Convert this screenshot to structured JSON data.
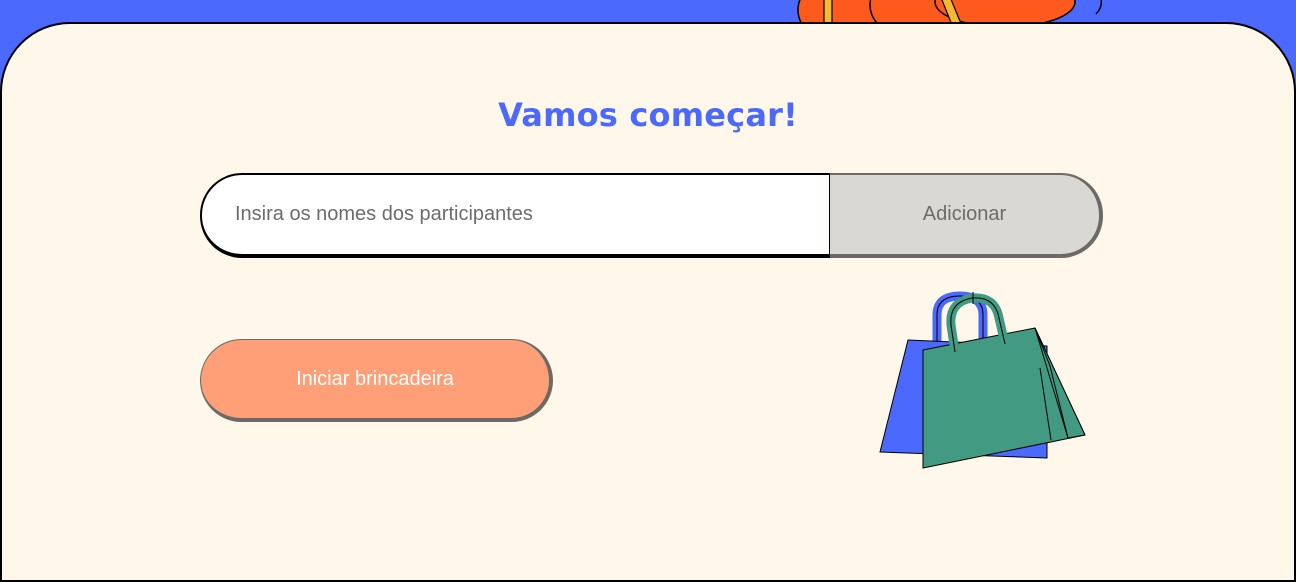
{
  "page": {
    "title": "Vamos começar!"
  },
  "form": {
    "name_placeholder": "Insira os nomes dos participantes",
    "name_value": "",
    "add_label": "Adicionar"
  },
  "actions": {
    "start_label": "Iniciar brincadeira"
  },
  "colors": {
    "header_bg": "#4b69fd",
    "card_bg": "#fff8ea",
    "title": "#4b69fd",
    "add_button": "#d9d8d2",
    "start_button": "#fe9f77",
    "bag_blue": "#4b69fd",
    "bag_green": "#419a81",
    "decor_orange": "#fe5a1d",
    "decor_yellow": "#f5b92f"
  },
  "icons": {
    "header_decoration": "orange-flower-illustration",
    "shopping_bags": "shopping-bags-illustration"
  }
}
